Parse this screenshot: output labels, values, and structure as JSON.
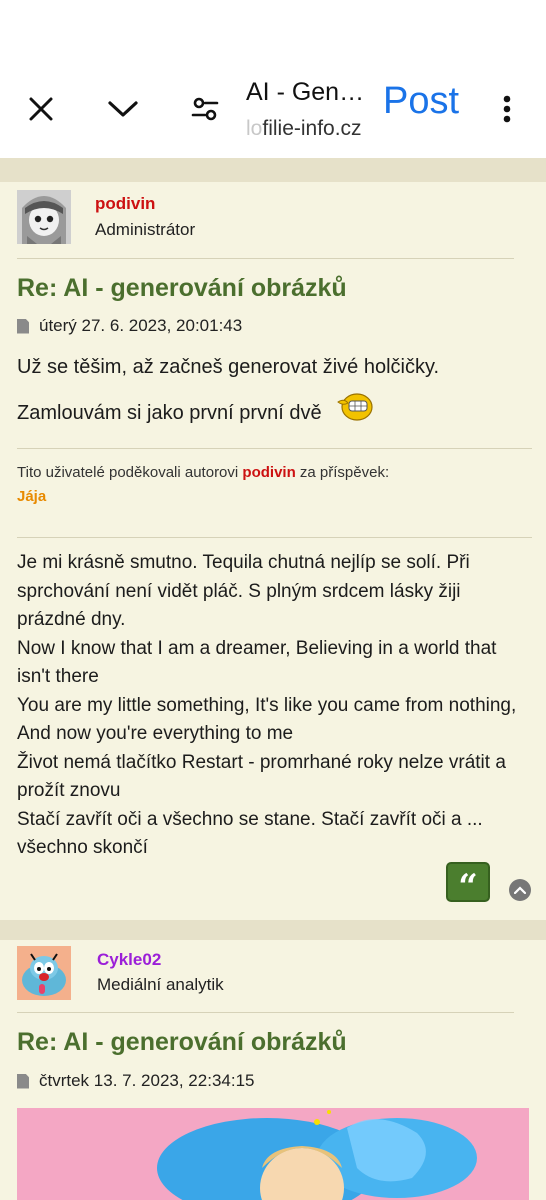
{
  "browser": {
    "page_title": "AI - Gen…",
    "url_faded": "lo",
    "url": "filie-info.cz",
    "post_label": "Post",
    "icons": [
      "close-icon",
      "chevron-down-icon",
      "tune-icon",
      "more-vert-icon"
    ]
  },
  "posts": [
    {
      "author": "podivin",
      "rank": "Administrátor",
      "title": "Re: AI - generování obrázků",
      "date": "úterý 27. 6. 2023, 20:01:43",
      "lines": [
        "Už se těšim, až začneš generovat živé holčičky.",
        "Zamlouvám si jako první první dvě"
      ],
      "thanks_prefix": "Tito uživatelé poděkovali autorovi",
      "thanks_author": "podivin",
      "thanks_suffix": "za příspěvek:",
      "thanked_by": "Jája",
      "signature": [
        "Je mi krásně smutno. Tequila chutná nejlíp se solí. Při sprchování není vidět pláč. S plným srdcem lásky žiji prázdné dny.",
        "Now I know that I am a dreamer, Believing in a world that isn't there",
        "You are my little something, It's like you came from nothing, And now you're everything to me",
        "Život nemá tlačítko Restart - promrhané roky nelze vrátit a prožít znovu",
        "Stačí zavřít oči a všechno se stane. Stačí zavřít oči a ... všechno skončí"
      ],
      "author_color": "#cc1111"
    },
    {
      "author": "Cykle02",
      "rank": "Mediální analytik",
      "title": "Re: AI - generování obrázků",
      "date": "čtvrtek 13. 7. 2023, 22:34:15",
      "author_color": "#9b1fd8"
    }
  ],
  "colors": {
    "title_green": "#4b6f2e",
    "post_bg": "#f6f4e1",
    "quote_green": "#4b7e2e",
    "post_blue": "#1a73e8"
  }
}
